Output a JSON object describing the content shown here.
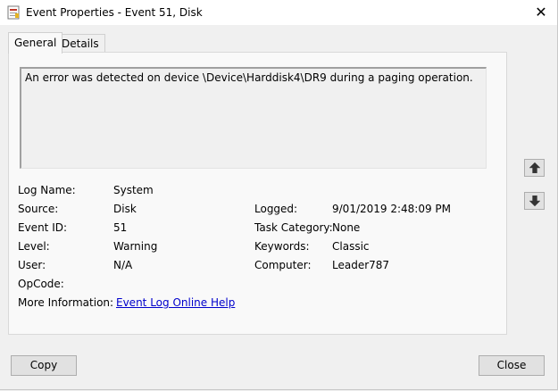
{
  "window": {
    "title": "Event Properties - Event 51, Disk",
    "close_glyph": "✕"
  },
  "tabs": [
    {
      "label": "General",
      "active": true
    },
    {
      "label": "Details",
      "active": false
    }
  ],
  "description": "An error was detected on device \\Device\\Harddisk4\\DR9 during a paging operation.",
  "fields": {
    "log_name": {
      "label": "Log Name:",
      "value": "System"
    },
    "source": {
      "label": "Source:",
      "value": "Disk"
    },
    "event_id": {
      "label": "Event ID:",
      "value": "51"
    },
    "level": {
      "label": "Level:",
      "value": "Warning"
    },
    "user": {
      "label": "User:",
      "value": "N/A"
    },
    "opcode": {
      "label": "OpCode:",
      "value": ""
    },
    "more_info": {
      "label": "More Information:",
      "link": "Event Log Online Help"
    },
    "logged": {
      "label": "Logged:",
      "value": "9/01/2019 2:48:09 PM"
    },
    "task_category": {
      "label": "Task Category:",
      "value": "None"
    },
    "keywords": {
      "label": "Keywords:",
      "value": "Classic"
    },
    "computer": {
      "label": "Computer:",
      "value": "Leader787"
    }
  },
  "nav": {
    "up_icon": "arrow-up-icon",
    "down_icon": "arrow-down-icon"
  },
  "buttons": {
    "copy": "Copy",
    "close": "Close"
  }
}
